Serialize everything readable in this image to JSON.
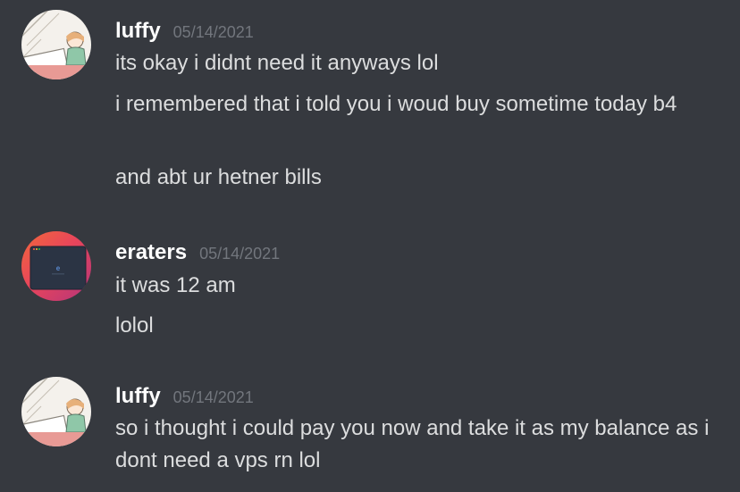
{
  "messages": [
    {
      "author": "luffy",
      "timestamp": "05/14/2021",
      "avatar_icon": "anime-girl-avatar-icon",
      "lines": [
        "its okay i didnt need it anyways lol",
        "i remembered that i told you i woud buy sometime today b4",
        "and abt ur hetner bills"
      ]
    },
    {
      "author": "eraters",
      "timestamp": "05/14/2021",
      "avatar_icon": "macos-window-avatar-icon",
      "avatar_letter": "e",
      "lines": [
        "it was 12 am",
        "lolol"
      ]
    },
    {
      "author": "luffy",
      "timestamp": "05/14/2021",
      "avatar_icon": "anime-girl-avatar-icon",
      "lines": [
        "so i thought i could pay you now and take it as my balance as i dont need a vps rn lol"
      ]
    }
  ],
  "colors": {
    "background": "#36393f",
    "username": "#ffffff",
    "timestamp": "#72767d",
    "message_text": "#dcddde"
  }
}
